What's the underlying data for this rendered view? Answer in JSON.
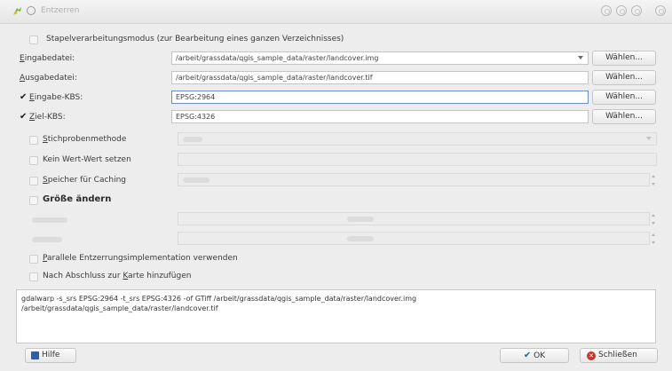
{
  "window": {
    "title": "Entzerren",
    "controls": [
      "help-button",
      "minimize-button",
      "maximize-button",
      "close-button"
    ]
  },
  "batch_mode": {
    "label": "Stapelverarbeitungsmodus (zur Bearbeitung eines ganzen Verzeichnisses)",
    "checked": false
  },
  "input_file": {
    "label_first": "E",
    "label_rest": "ingabedatei:",
    "value": "/arbeit/grassdata/qgis_sample_data/raster/landcover.img",
    "button": "Wählen..."
  },
  "output_file": {
    "label_first": "A",
    "label_rest": "usgabedatei:",
    "value": "/arbeit/grassdata/qgis_sample_data/raster/landcover.tif",
    "button": "Wählen..."
  },
  "source_crs": {
    "label_first": "E",
    "label_rest": "ingabe-KBS:",
    "checked": true,
    "value": "EPSG:2964",
    "button": "Wählen..."
  },
  "target_crs": {
    "label_first": "Z",
    "label_rest": "iel-KBS:",
    "checked": true,
    "value": "EPSG:4326",
    "button": "Wählen..."
  },
  "resampling": {
    "label_first": "S",
    "label_rest": "tichprobenmethode",
    "checked": false
  },
  "no_data": {
    "label": "Kein Wert-Wert setzen",
    "checked": false
  },
  "cache": {
    "label_first": "S",
    "label_rest": "peicher für Caching",
    "checked": false
  },
  "resize": {
    "label": "Größe ändern",
    "checked": false
  },
  "parallel": {
    "label_first": "P",
    "label_rest": "arallele Entzerrungsimplementation verwenden",
    "checked": false
  },
  "add_to_map": {
    "label_before": "Nach Abschluss zur ",
    "label_underlined": "K",
    "label_after": "arte hinzufügen",
    "checked": false
  },
  "command": {
    "line1": "gdalwarp -s_srs EPSG:2964 -t_srs EPSG:4326 -of GTiff /arbeit/grassdata/qgis_sample_data/raster/landcover.img",
    "line2": "/arbeit/grassdata/qgis_sample_data/raster/landcover.tif"
  },
  "buttons": {
    "help": "Hilfe",
    "ok": "OK",
    "close": "Schließen"
  },
  "colors": {
    "window_bg": "#ededed",
    "focus_border": "#6c8fc5",
    "close_icon": "#c0392b",
    "ok_check": "#2a5db0",
    "help_icon": "#2f5fa8"
  }
}
